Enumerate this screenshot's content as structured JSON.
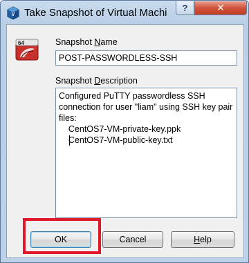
{
  "window": {
    "title": "Take Snapshot of Virtual Machi",
    "help_glyph": "?",
    "close_glyph": "✕"
  },
  "snapshot": {
    "name_label_pre": "Snapshot ",
    "name_label_key": "N",
    "name_label_post": "ame",
    "name_value": "POST-PASSWORDLESS-SSH",
    "desc_label_pre": "Snapshot ",
    "desc_label_key": "D",
    "desc_label_post": "escription",
    "description": "Configured PuTTY passwordless SSH connection for user \"liam\" using SSH key pair files:\n    CentOS7-VM-private-key.ppk\n    CentOS7-VM-public-key.txt",
    "badge": "64"
  },
  "buttons": {
    "ok": "OK",
    "cancel": "Cancel",
    "help_key": "H",
    "help_rest": "elp"
  },
  "colors": {
    "highlight": "#e0192a",
    "close": "#c7432a"
  },
  "icons": {
    "app": "virtualbox-icon",
    "vm": "vm-64bit-icon"
  }
}
